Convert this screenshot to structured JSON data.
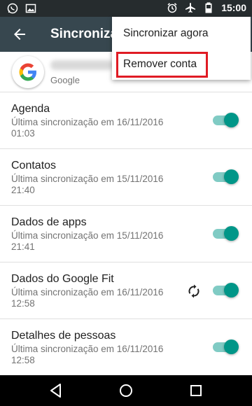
{
  "status_bar": {
    "time": "15:00",
    "left_icons": [
      "whatsapp-icon",
      "image-icon"
    ],
    "right_icons": [
      "alarm-icon",
      "airplane-icon",
      "battery-icon"
    ]
  },
  "toolbar": {
    "title": "Sincronizar"
  },
  "account": {
    "provider": "Google"
  },
  "menu": {
    "items": [
      "Sincronizar agora",
      "Remover conta"
    ],
    "highlight_color": "#e01b24"
  },
  "sync_items": [
    {
      "name": "Agenda",
      "sub": "Última sincronização em 16/11/2016 01:03",
      "enabled": true,
      "syncing": false
    },
    {
      "name": "Contatos",
      "sub": "Última sincronização em 15/11/2016 21:40",
      "enabled": true,
      "syncing": false
    },
    {
      "name": "Dados de apps",
      "sub": "Última sincronização em 15/11/2016 21:41",
      "enabled": true,
      "syncing": false
    },
    {
      "name": "Dados do Google Fit",
      "sub": "Última sincronização em 16/11/2016 12:58",
      "enabled": true,
      "syncing": true
    },
    {
      "name": "Detalhes de pessoas",
      "sub": "Última sincronização em 16/11/2016 12:58",
      "enabled": true,
      "syncing": false
    }
  ],
  "colors": {
    "toolbar": "#37474f",
    "accent": "#009688"
  }
}
